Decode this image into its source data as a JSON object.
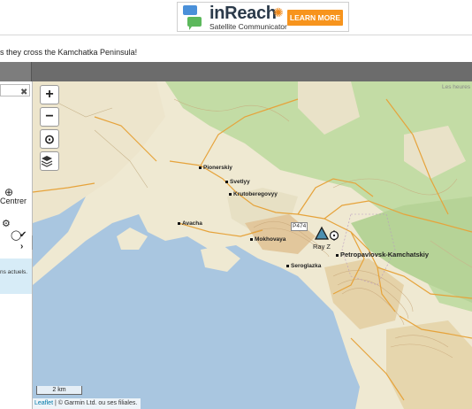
{
  "banner": {
    "brand": "inReach",
    "subtitle": "Satellite Communicator",
    "cta": "LEARN MORE"
  },
  "info_text": "s they cross the Kamchatka Peninsula!",
  "left_panel": {
    "close_glyph": "✖",
    "centre_icon": "⊕",
    "centre_label": "Centrer",
    "settings_icon": "⚙",
    "record_icon": "◯",
    "check_icon": "✔",
    "arrow_icon": "›",
    "message": "ns actuels.",
    "handle_icon": "◀"
  },
  "map": {
    "zoom_in": "+",
    "zoom_out": "−",
    "locate_icon": "⊙",
    "layers_icon": "layers-icon",
    "scale": "2 km",
    "attribution_leaflet": "Leaflet",
    "attribution_rest": " | © Garmin Ltd. ou ses filiales.",
    "corner_text": "Les heures",
    "places": {
      "pionerskiy": "Pionerskiy",
      "svetlyy": "Svetlyy",
      "krutoberegovyy": "Krutoberegovyy",
      "avacha": "Avacha",
      "mokhovaya": "Mokhovaya",
      "seroglazka": "Seroglazka",
      "petropavlovsk": "Petropavlovsk-Kamchatskiy"
    },
    "road_label": "P474",
    "tracker_label": "Ray Z"
  },
  "colors": {
    "water": "#a9c6e0",
    "land": "#efe9d2",
    "forest": "#bfd9a2",
    "roads": "#e6a33b",
    "accent": "#f7941d"
  }
}
